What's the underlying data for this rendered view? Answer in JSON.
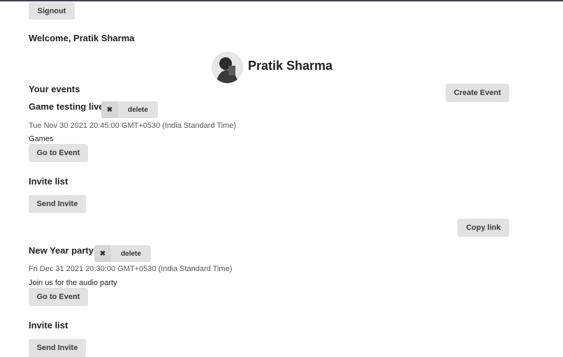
{
  "header": {
    "signout_label": "Signout",
    "welcome": "Welcome, Pratik Sharma"
  },
  "profile": {
    "name": "Pratik Sharma"
  },
  "events_section": {
    "title": "Your events",
    "create_label": "Create Event"
  },
  "events": [
    {
      "name": "Game testing live",
      "delete_label": "delete",
      "date": "Tue Nov 30 2021 20:45:00 GMT+0530 (India Standard Time)",
      "description": "Games",
      "go_label": "Go to Event",
      "invite_title": "Invite list",
      "invite_label": "Send Invite",
      "copy_label": "Copy link"
    },
    {
      "name": "New Year party",
      "delete_label": "delete",
      "date": "Fri Dec 31 2021 20:30:00 GMT+0530 (India Standard Time)",
      "description": "Join us for the audio party",
      "go_label": "Go to Event",
      "invite_title": "Invite list",
      "invite_label": "Send Invite"
    }
  ],
  "icons": {
    "delete": "close-icon"
  },
  "colors": {
    "button_bg": "#e2e2e4",
    "topbar": "#3c4250"
  }
}
